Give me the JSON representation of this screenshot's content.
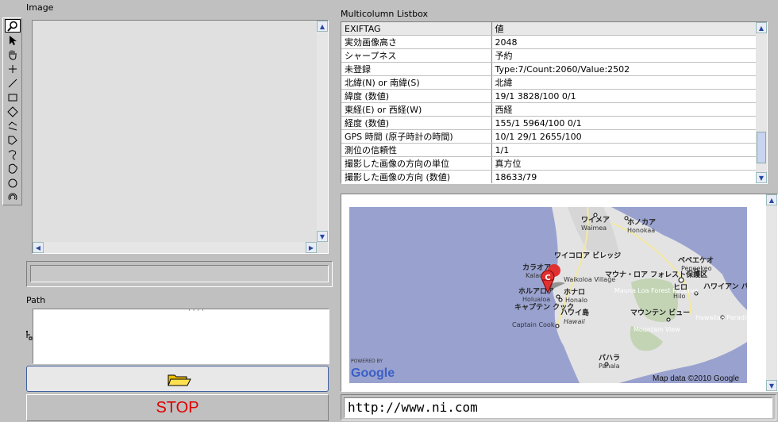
{
  "image_panel": {
    "label": "Image"
  },
  "toolbar": {
    "tools": [
      "zoom-icon",
      "pointer-icon",
      "pan-icon",
      "crosshair-icon",
      "line-icon",
      "rectangle-icon",
      "rotated-rect-icon",
      "polyline-icon",
      "polygon-icon",
      "freehand-line-icon",
      "freehand-region-icon",
      "oval-icon",
      "annulus-icon"
    ]
  },
  "listbox": {
    "label": "Multicolumn Listbox",
    "columns": [
      "EXIFTAG",
      "値"
    ],
    "rows": [
      [
        "実効画像高さ",
        "2048"
      ],
      [
        "シャープネス",
        "予約"
      ],
      [
        "未登録",
        "Type:7/Count:2060/Value:2502"
      ],
      [
        "北緯(N) or 南緯(S)",
        "北緯"
      ],
      [
        "緯度 (数値)",
        "19/1 3828/100 0/1"
      ],
      [
        "東経(E) or 西経(W)",
        "西経"
      ],
      [
        "経度 (数値)",
        "155/1 5964/100 0/1"
      ],
      [
        "GPS 時間 (原子時計の時間)",
        "10/1  29/1  2655/100"
      ],
      [
        "測位の信頼性",
        "1/1"
      ],
      [
        "撮影した画像の方向の単位",
        "真方位"
      ],
      [
        "撮影した画像の方向 (数値)",
        "18633/79"
      ]
    ]
  },
  "path_panel": {
    "label": "Path",
    "path_text": "·  ·  ·  ·"
  },
  "stop_button": {
    "label": "STOP"
  },
  "map": {
    "labels": [
      {
        "jp": "ワイメア",
        "en": "Waimea"
      },
      {
        "jp": "ホノカア",
        "en": "Honokaa"
      },
      {
        "jp": "ワイコロア ビレッジ",
        "en": "Waikoloa Village"
      },
      {
        "jp": "カラオア",
        "en": "Kalaoa"
      },
      {
        "jp": "ペペエケオ",
        "en": "Pepeekeo"
      },
      {
        "jp": "マウナ・ロア フォレスト保護区",
        "en": "Mauna Loa Forest Reserve"
      },
      {
        "jp": "ヒロ",
        "en": "Hilo"
      },
      {
        "jp": "ハワイアン パラダイス パーク",
        "en": "Hawaiian Paradise Park"
      },
      {
        "jp": "ホルアロア",
        "en": "Holualoa"
      },
      {
        "jp": "ホナロ",
        "en": "Honalo"
      },
      {
        "jp": "キャプテン クック",
        "en": "Captain Cook"
      },
      {
        "jp": "ハワイ島",
        "en": "Hawaii"
      },
      {
        "jp": "マウンテン ビュー",
        "en": "Mountain View"
      },
      {
        "jp": "パハラ",
        "en": "Pahala"
      }
    ],
    "marker": "C",
    "powered_by": "POWERED BY",
    "google": "Google",
    "attribution": "Map data ©2010 Google"
  },
  "url_field": {
    "value": "http://www.ni.com"
  }
}
